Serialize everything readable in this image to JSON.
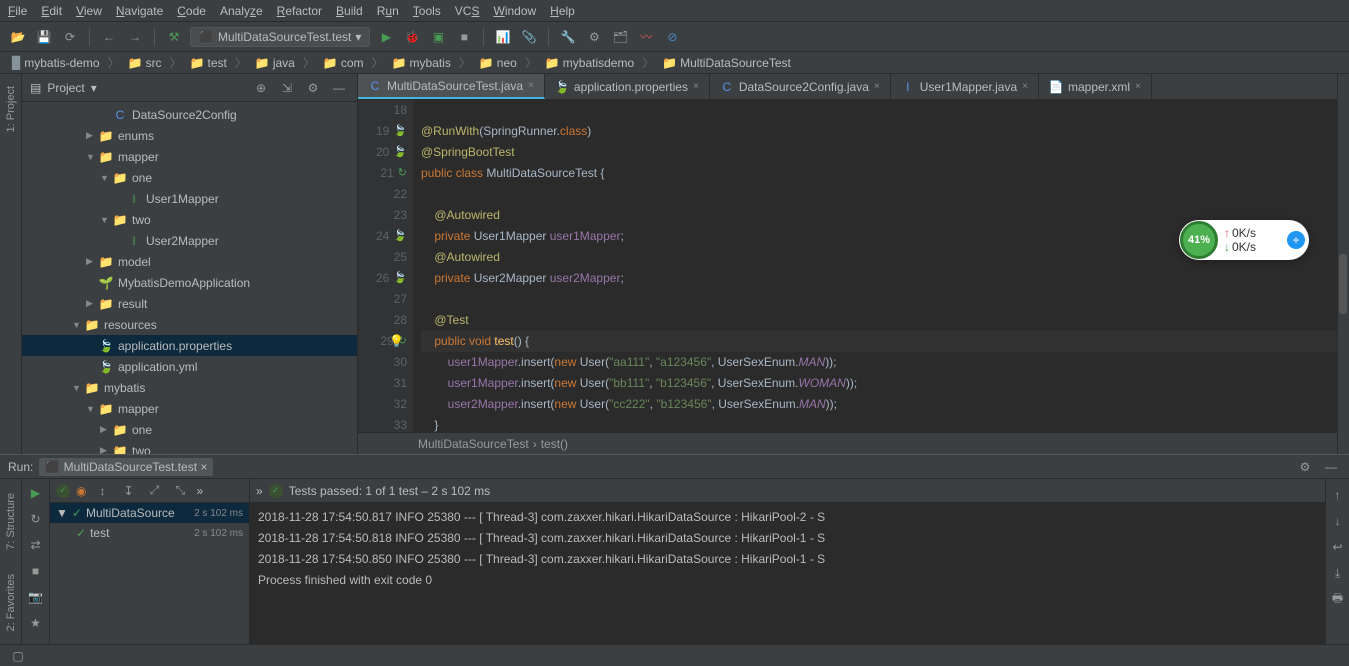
{
  "menu": [
    "File",
    "Edit",
    "View",
    "Navigate",
    "Code",
    "Analyze",
    "Refactor",
    "Build",
    "Run",
    "Tools",
    "VCS",
    "Window",
    "Help"
  ],
  "runConfig": "MultiDataSourceTest.test",
  "breadcrumbs": [
    "mybatis-demo",
    "src",
    "test",
    "java",
    "com",
    "mybatis",
    "neo",
    "mybatisdemo",
    "MultiDataSourceTest"
  ],
  "projectLabel": "Project",
  "tree": [
    {
      "indent": 5,
      "arrow": "",
      "icon": "C",
      "label": "DataSource2Config",
      "iconClass": "java-ic"
    },
    {
      "indent": 4,
      "arrow": "▶",
      "icon": "📁",
      "label": "enums",
      "iconClass": "folder-ic"
    },
    {
      "indent": 4,
      "arrow": "▼",
      "icon": "📁",
      "label": "mapper",
      "iconClass": "folder-ic"
    },
    {
      "indent": 5,
      "arrow": "▼",
      "icon": "📁",
      "label": "one",
      "iconClass": "folder-ic"
    },
    {
      "indent": 6,
      "arrow": "",
      "icon": "I",
      "label": "User1Mapper",
      "iconClass": "green-dot"
    },
    {
      "indent": 5,
      "arrow": "▼",
      "icon": "📁",
      "label": "two",
      "iconClass": "folder-ic"
    },
    {
      "indent": 6,
      "arrow": "",
      "icon": "I",
      "label": "User2Mapper",
      "iconClass": "green-dot"
    },
    {
      "indent": 4,
      "arrow": "▶",
      "icon": "📁",
      "label": "model",
      "iconClass": "folder-ic"
    },
    {
      "indent": 4,
      "arrow": "",
      "icon": "🌱",
      "label": "MybatisDemoApplication",
      "iconClass": "green-dot"
    },
    {
      "indent": 4,
      "arrow": "▶",
      "icon": "📁",
      "label": "result",
      "iconClass": "folder-ic"
    },
    {
      "indent": 3,
      "arrow": "▼",
      "icon": "📁",
      "label": "resources",
      "iconClass": "folder-ic"
    },
    {
      "indent": 4,
      "arrow": "",
      "icon": "🍃",
      "label": "application.properties",
      "iconClass": "green-dot",
      "sel": true
    },
    {
      "indent": 4,
      "arrow": "",
      "icon": "🍃",
      "label": "application.yml",
      "iconClass": "green-dot"
    },
    {
      "indent": 3,
      "arrow": "▼",
      "icon": "📁",
      "label": "mybatis",
      "iconClass": "folder-ic"
    },
    {
      "indent": 4,
      "arrow": "▼",
      "icon": "📁",
      "label": "mapper",
      "iconClass": "folder-ic"
    },
    {
      "indent": 5,
      "arrow": "▶",
      "icon": "📁",
      "label": "one",
      "iconClass": "folder-ic"
    },
    {
      "indent": 5,
      "arrow": "▶",
      "icon": "📁",
      "label": "two",
      "iconClass": "folder-ic"
    }
  ],
  "tabs": [
    {
      "label": "MultiDataSourceTest.java",
      "icon": "C",
      "active": true
    },
    {
      "label": "application.properties",
      "icon": "🍃"
    },
    {
      "label": "DataSource2Config.java",
      "icon": "C"
    },
    {
      "label": "User1Mapper.java",
      "icon": "I"
    },
    {
      "label": "mapper.xml",
      "icon": "📄"
    }
  ],
  "lines": [
    {
      "n": 18,
      "html": ""
    },
    {
      "n": 19,
      "icon": "🍃",
      "html": "<span class='k-olive'>@RunWith</span><span class='k-gray'>(SpringRunner.</span><span class='k-orange'>class</span><span class='k-gray'>)</span>"
    },
    {
      "n": 20,
      "icon": "🍃",
      "html": "<span class='k-olive'>@SpringBootTest</span>"
    },
    {
      "n": 21,
      "icon": "↻",
      "html": "<span class='k-orange'>public class </span><span class='k-gray'>MultiDataSourceTest {</span>"
    },
    {
      "n": 22,
      "html": ""
    },
    {
      "n": 23,
      "html": "    <span class='k-olive'>@Autowired</span>"
    },
    {
      "n": 24,
      "icon": "🍃",
      "html": "    <span class='k-orange'>private </span><span class='k-gray'>User1Mapper </span><span class='k-purple'>user1Mapper</span><span class='k-gray'>;</span>"
    },
    {
      "n": 25,
      "html": "    <span class='k-olive'>@Autowired</span>"
    },
    {
      "n": 26,
      "icon": "🍃",
      "html": "    <span class='k-orange'>private </span><span class='k-gray'>User2Mapper </span><span class='k-purple'>user2Mapper</span><span class='k-gray'>;</span>"
    },
    {
      "n": 27,
      "html": ""
    },
    {
      "n": 28,
      "html": "    <span class='k-olive'>@Test</span>"
    },
    {
      "n": 29,
      "icon": "↻",
      "bulb": true,
      "cur": true,
      "html": "    <span class='k-orange'>public void </span><span class='k-yellow'>test</span><span class='k-gray'>() {</span>"
    },
    {
      "n": 30,
      "html": "        <span class='k-purple'>user1Mapper</span><span class='k-gray'>.insert(</span><span class='k-orange'>new </span><span class='k-gray'>User(</span><span class='k-green'>\"aa111\"</span><span class='k-gray'>, </span><span class='k-green'>\"a123456\"</span><span class='k-gray'>, UserSexEnum.</span><span class='k-it'>MAN</span><span class='k-gray'>));</span>"
    },
    {
      "n": 31,
      "html": "        <span class='k-purple'>user1Mapper</span><span class='k-gray'>.insert(</span><span class='k-orange'>new </span><span class='k-gray'>User(</span><span class='k-green'>\"bb111\"</span><span class='k-gray'>, </span><span class='k-green'>\"b123456\"</span><span class='k-gray'>, UserSexEnum.</span><span class='k-it'>WOMAN</span><span class='k-gray'>));</span>"
    },
    {
      "n": 32,
      "html": "        <span class='k-purple'>user2Mapper</span><span class='k-gray'>.insert(</span><span class='k-orange'>new </span><span class='k-gray'>User(</span><span class='k-green'>\"cc222\"</span><span class='k-gray'>, </span><span class='k-green'>\"b123456\"</span><span class='k-gray'>, UserSexEnum.</span><span class='k-it'>MAN</span><span class='k-gray'>));</span>"
    },
    {
      "n": 33,
      "html": "    <span class='k-gray'>}</span>"
    }
  ],
  "editorBc": [
    "MultiDataSourceTest",
    "test()"
  ],
  "runLabel": "Run:",
  "runTab": "MultiDataSourceTest.test",
  "testStatus": "Tests passed: 1 of 1 test – 2 s 102 ms",
  "testTree": [
    {
      "label": "MultiDataSource",
      "time": "2 s 102 ms",
      "sel": true,
      "arrow": "▼"
    },
    {
      "label": "test",
      "time": "2 s 102 ms",
      "indent": 1
    }
  ],
  "console": [
    "2018-11-28 17:54:50.817  INFO 25380 --- [       Thread-3] com.zaxxer.hikari.HikariDataSource       : HikariPool-2 - S",
    "2018-11-28 17:54:50.818  INFO 25380 --- [       Thread-3] com.zaxxer.hikari.HikariDataSource       : HikariPool-1 - S",
    "2018-11-28 17:54:50.850  INFO 25380 --- [       Thread-3] com.zaxxer.hikari.HikariDataSource       : HikariPool-1 - S",
    "",
    "Process finished with exit code 0"
  ],
  "leftTabs": [
    "1: Project",
    "7: Structure",
    "2: Favorites"
  ],
  "widget": {
    "pct": "41%",
    "up": "0K/s",
    "down": "0K/s"
  }
}
